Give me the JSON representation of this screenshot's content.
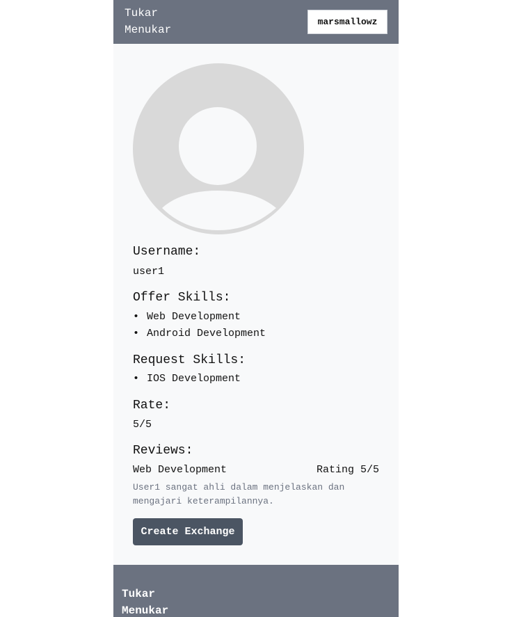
{
  "header": {
    "brand": "Tukar Menukar",
    "user_button": "marsmallowz"
  },
  "profile": {
    "avatar_icon": "default-user-avatar",
    "username_label": "Username:",
    "username": "user1",
    "offer_label": "Offer Skills:",
    "offer_skills": [
      "Web Development",
      "Android Development"
    ],
    "request_label": "Request Skills:",
    "request_skills": [
      "IOS Development"
    ],
    "rate_label": "Rate:",
    "rate": "5/5",
    "reviews_label": "Reviews:",
    "reviews": [
      {
        "skill": "Web Development",
        "rating": "Rating 5/5",
        "text": "User1 sangat ahli dalam menjelaskan dan mengajari keterampilannya."
      }
    ],
    "create_button": "Create Exchange"
  },
  "footer": {
    "brand": "Tukar Menukar"
  },
  "colors": {
    "header_bg": "#6b7280",
    "page_bg": "#f8f9fa",
    "button_bg": "#4b5563",
    "avatar_fill": "#d9d9d9"
  }
}
